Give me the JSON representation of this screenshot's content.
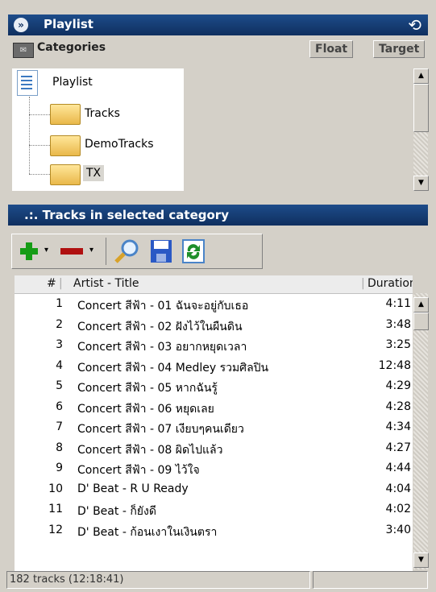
{
  "window": {
    "title": "Playlist",
    "pin_icon": "pin-icon"
  },
  "categories": {
    "label": "Categories",
    "float_label": "Float",
    "target_label": "Target"
  },
  "tree": {
    "root": "Playlist",
    "items": [
      "Tracks",
      "DemoTracks",
      "TX"
    ],
    "selected": "TX"
  },
  "tracks_panel": {
    "title": ".:. Tracks in selected category"
  },
  "toolbar": {
    "icons": [
      "add-icon",
      "remove-icon",
      "search-icon",
      "save-icon",
      "refresh-icon"
    ],
    "colors": {
      "add": "#169c16",
      "remove": "#b01010",
      "save": "#2a59c5",
      "refresh": "#1e8f2a"
    }
  },
  "table": {
    "columns": [
      "#",
      "Artist - Title",
      "Duration"
    ],
    "rows": [
      {
        "n": "1",
        "title": "Concert สีฟ้า - 01 ฉันจะอยู่กับเธอ",
        "duration": "4:11"
      },
      {
        "n": "2",
        "title": "Concert สีฟ้า - 02 ฝังไว้ในผืนดิน",
        "duration": "3:48"
      },
      {
        "n": "3",
        "title": "Concert สีฟ้า - 03 อยากหยุดเวลา",
        "duration": "3:25"
      },
      {
        "n": "4",
        "title": "Concert สีฟ้า - 04 Medley รวมศิลปิน",
        "duration": "12:48"
      },
      {
        "n": "5",
        "title": "Concert สีฟ้า - 05 หากฉันรู้",
        "duration": "4:29"
      },
      {
        "n": "6",
        "title": "Concert สีฟ้า - 06 หยุดเลย",
        "duration": "4:28"
      },
      {
        "n": "7",
        "title": "Concert สีฟ้า - 07 เงียบๆคนเดียว",
        "duration": "4:34"
      },
      {
        "n": "8",
        "title": "Concert สีฟ้า - 08 ผิดไปแล้ว",
        "duration": "4:27"
      },
      {
        "n": "9",
        "title": "Concert สีฟ้า - 09 ไว้ใจ",
        "duration": "4:44"
      },
      {
        "n": "10",
        "title": "D' Beat - R U Ready",
        "duration": "4:04"
      },
      {
        "n": "11",
        "title": "D' Beat - ก็ยังดี",
        "duration": "4:02"
      },
      {
        "n": "12",
        "title": "D' Beat - ก้อนเงาในเงินตรา",
        "duration": "3:40"
      }
    ]
  },
  "status": {
    "count": "182 tracks (12:18:41)"
  },
  "accent": "#123a72"
}
